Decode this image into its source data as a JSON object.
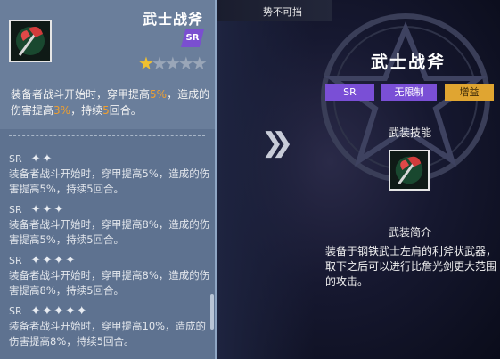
{
  "left_panel": {
    "title": "武士战斧",
    "rarity_badge": "SR",
    "stars": {
      "filled": 1,
      "total": 5
    },
    "desc": {
      "p1": "装备者战斗开始时，穿甲提高",
      "v1": "5%",
      "p2": "，造成的伤害提高",
      "v2": "3%",
      "p3": "，持续",
      "v3": "5",
      "p4": "回合。"
    },
    "tiers": [
      {
        "rarity": "SR",
        "stars": "✦✦",
        "text": "装备者战斗开始时，穿甲提高5%，造成的伤害提高5%，持续5回合。"
      },
      {
        "rarity": "SR",
        "stars": "✦✦✦",
        "text": "装备者战斗开始时，穿甲提高8%，造成的伤害提高5%，持续5回合。"
      },
      {
        "rarity": "SR",
        "stars": "✦✦✦✦",
        "text": "装备者战斗开始时，穿甲提高8%，造成的伤害提高8%，持续5回合。"
      },
      {
        "rarity": "SR",
        "stars": "✦✦✦✦✦",
        "text": "装备者战斗开始时，穿甲提高10%，造成的伤害提高8%，持续5回合。"
      }
    ]
  },
  "top_bar": {
    "text": "势不可挡"
  },
  "right_panel": {
    "title": "武士战斧",
    "tags": {
      "rarity": "SR",
      "unlimited": "无限制",
      "buff": "增益"
    },
    "skill_label": "武装技能",
    "intro_label": "武装简介",
    "intro_text": "装备于钢铁武士左肩的利斧状武器，取下之后可以进行比詹光剑更大范围的攻击。"
  },
  "colors": {
    "highlight": "#f0a030",
    "sr_purple": "#7a4fd6",
    "buff_gold": "#e0a531"
  }
}
